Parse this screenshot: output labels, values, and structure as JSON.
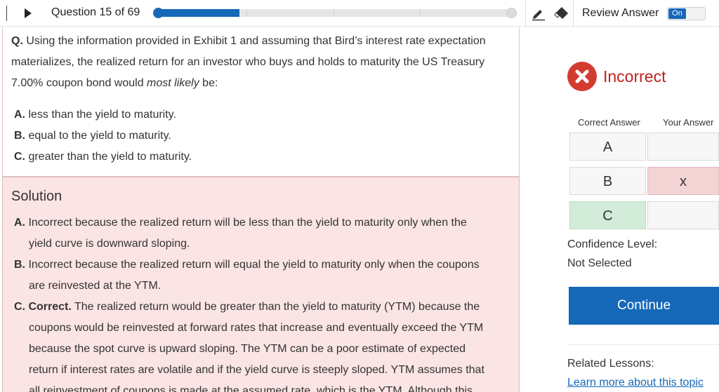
{
  "header": {
    "question_counter": "Question 15 of 69",
    "progress": 0.23,
    "review_label": "Review Answer",
    "toggle_label": "On",
    "colors": {
      "accent": "#1668b8",
      "track": "#e6e6e6"
    },
    "icons": [
      "play-icon",
      "pencil-icon",
      "eraser-icon"
    ]
  },
  "question": {
    "prefix": "Q.",
    "line1": "Using the information provided in Exhibit 1 and assuming that Bird’s interest rate expectation",
    "line2": "materializes, the realized return for an investor who buys and holds to maturity the US Treasury",
    "line3_a": "7.00% coupon bond would ",
    "line3_em": "most likely",
    "line3_b": " be:",
    "options": [
      {
        "letter": "A.",
        "text": "less than the yield to maturity."
      },
      {
        "letter": "B.",
        "text": "equal to the yield to maturity."
      },
      {
        "letter": "C.",
        "text": "greater than the yield to maturity."
      }
    ]
  },
  "solution": {
    "title": "Solution",
    "a_letter": "A.",
    "a_line1": "Incorrect because the realized return will be less than the yield to maturity only when the",
    "a_line2": "yield curve is downward sloping.",
    "b_letter": "B.",
    "b_line1": "Incorrect because the realized return will equal the yield to maturity only when the coupons",
    "b_line2": "are reinvested at the YTM.",
    "c_letter": "C.",
    "c_correct": "Correct.",
    "c_line1": "The realized return would be greater than the yield to maturity (YTM) because the",
    "c_line2": "coupons would be reinvested at forward rates that increase and eventually exceed the YTM",
    "c_line3": "because the spot curve is upward sloping. The YTM can be a poor estimate of expected",
    "c_line4": "return if interest rates are volatile and if the yield curve is steeply sloped. YTM assumes that",
    "c_line5": "all reinvestment of coupons is made at the assumed rate, which is the YTM. Although this"
  },
  "result": {
    "status": "Incorrect",
    "icon": "x-circle-icon",
    "color": "#c0211b",
    "correct_answer_header": "Correct Answer",
    "your_answer_header": "Your Answer",
    "rows": [
      {
        "letter": "A",
        "mark": ""
      },
      {
        "letter": "B",
        "mark": "x"
      },
      {
        "letter": "C",
        "mark": ""
      }
    ],
    "confidence_label": "Confidence Level:",
    "confidence_value": "Not Selected",
    "continue_label": "Continue",
    "related_label": "Related Lessons:",
    "related_link": "Learn more about this topic"
  }
}
